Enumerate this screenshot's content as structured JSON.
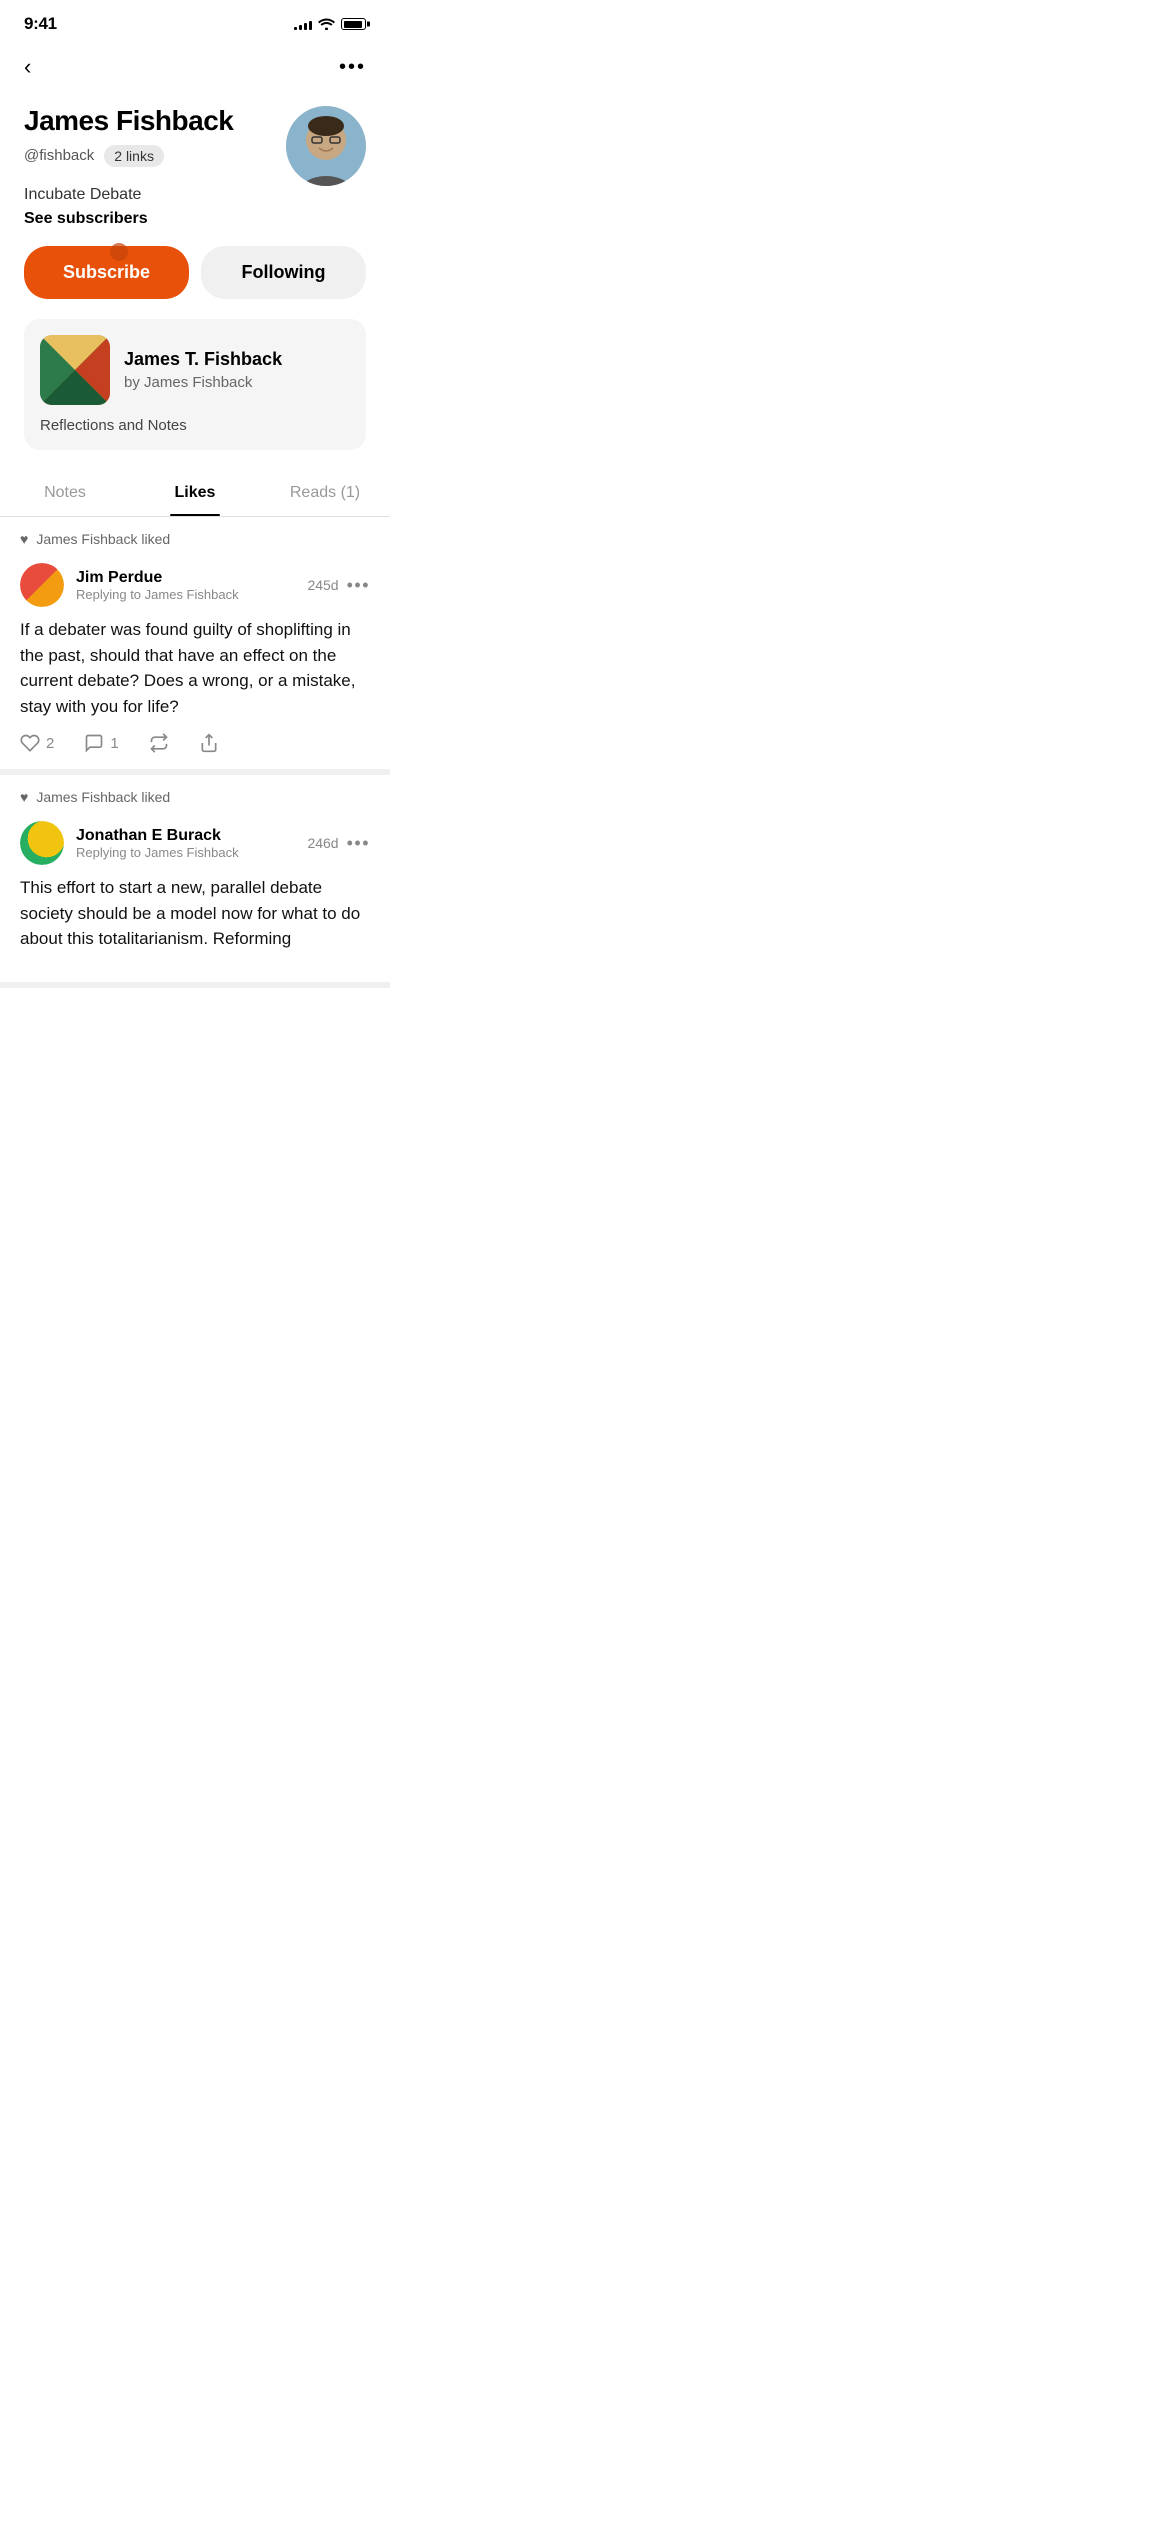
{
  "statusBar": {
    "time": "9:41",
    "signalBars": [
      3,
      5,
      7,
      9,
      11
    ],
    "battery": 90
  },
  "nav": {
    "backLabel": "‹",
    "moreLabel": "•••"
  },
  "profile": {
    "name": "James Fishback",
    "handle": "@fishback",
    "linksLabel": "2 links",
    "bio": "Incubate Debate",
    "subscribersLabel": "See subscribers",
    "subscribeButton": "Subscribe",
    "followingButton": "Following"
  },
  "newsletter": {
    "title": "James T. Fishback",
    "author": "by James Fishback",
    "description": "Reflections and Notes"
  },
  "tabs": {
    "notes": "Notes",
    "likes": "Likes",
    "reads": "Reads (1)"
  },
  "feed": [
    {
      "likedBy": "James Fishback liked",
      "authorName": "Jim Perdue",
      "replyTo": "Replying to James Fishback",
      "timeAgo": "245d",
      "text": "If a debater was found guilty of shoplifting in the past, should that have an effect on the current debate? Does a wrong, or a mistake, stay with you for life?",
      "likes": 2,
      "comments": 1,
      "reposts": "",
      "share": ""
    },
    {
      "likedBy": "James Fishback liked",
      "authorName": "Jonathan E Burack",
      "replyTo": "Replying to James Fishback",
      "timeAgo": "246d",
      "text": "This effort to start a new, parallel debate society should be a model now for what to do about this totalitarianism. Reforming",
      "likes": "",
      "comments": "",
      "reposts": "",
      "share": ""
    }
  ]
}
